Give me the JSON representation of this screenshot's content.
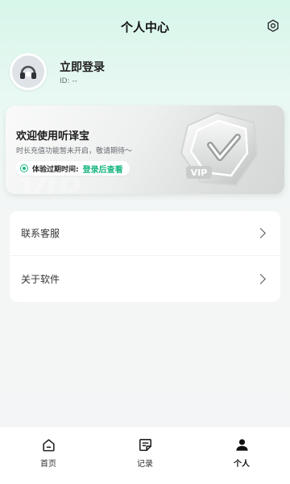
{
  "header": {
    "title": "个人中心",
    "settings_icon": "gear-icon"
  },
  "profile": {
    "login_label": "立即登录",
    "id_label": "ID: --",
    "avatar_icon": "headphones-avatar-icon"
  },
  "vip_card": {
    "title": "欢迎使用听译宝",
    "subtitle": "时长充值功能暂未开启，敬请期待～",
    "expire_label": "体验过期时间:",
    "expire_link": "登录后查看",
    "badge_text": "VIP",
    "accent_color": "#17b67f"
  },
  "menu": {
    "items": [
      {
        "label": "联系客服",
        "icon": "chevron-right-icon"
      },
      {
        "label": "关于软件",
        "icon": "chevron-right-icon"
      }
    ]
  },
  "bottom_nav": {
    "items": [
      {
        "label": "首页",
        "icon": "home-icon",
        "active": false
      },
      {
        "label": "记录",
        "icon": "records-icon",
        "active": false
      },
      {
        "label": "个人",
        "icon": "person-icon",
        "active": true
      }
    ]
  }
}
